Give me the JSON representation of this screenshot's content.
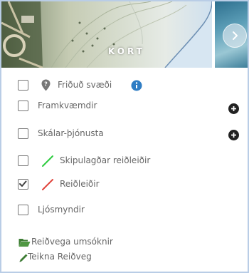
{
  "map": {
    "label": "KORT"
  },
  "layers": [
    {
      "label": "Friðuð svæði",
      "checked": false,
      "icon": "location-pin-icon",
      "info": true
    },
    {
      "label": "Framkvæmdir",
      "checked": false,
      "expandable": true
    },
    {
      "label": "Skálar-þjónusta",
      "checked": false,
      "expandable": true
    },
    {
      "label": "Skipulagðar reiðleiðir",
      "checked": false,
      "line_color": "#2ecc40"
    },
    {
      "label": "Reiðleiðir",
      "checked": true,
      "line_color": "#e0423a"
    },
    {
      "label": "Ljósmyndir",
      "checked": false
    }
  ],
  "links": {
    "applications": "Reiðvega umsóknir",
    "draw": "Teikna Reiðveg"
  },
  "colors": {
    "folder": "#3e7d34",
    "pencil": "#3e7d34",
    "info": "#2f7dc4",
    "plus": "#222222"
  }
}
